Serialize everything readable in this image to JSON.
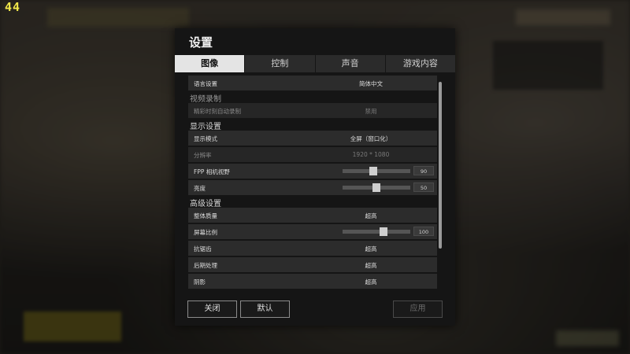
{
  "overlay": {
    "fps": "44"
  },
  "dialog": {
    "title": "设置",
    "tabs": [
      {
        "label": "图像",
        "active": true
      },
      {
        "label": "控制",
        "active": false
      },
      {
        "label": "声音",
        "active": false
      },
      {
        "label": "游戏内容",
        "active": false
      }
    ],
    "sections": {
      "language": {
        "label": "语言设置",
        "value": "简体中文"
      },
      "video_recording": {
        "title": "视频录制",
        "highlight": {
          "label": "精彩时刻自动录制",
          "value": "禁用"
        }
      },
      "display": {
        "title": "显示设置",
        "mode": {
          "label": "显示模式",
          "value": "全屏（窗口化）"
        },
        "resolution": {
          "label": "分辨率",
          "value": "1920 * 1080"
        },
        "fov": {
          "label": "FPP 相机视野",
          "value": "90",
          "slider_fraction": 0.45
        },
        "brightness": {
          "label": "亮度",
          "value": "50",
          "slider_fraction": 0.5
        }
      },
      "advanced": {
        "title": "高级设置",
        "overall_quality": {
          "label": "整体质量",
          "value": "超高"
        },
        "screen_scale": {
          "label": "屏幕比例",
          "value": "100",
          "slider_fraction": 0.6
        },
        "anti_aliasing": {
          "label": "抗锯齿",
          "value": "超高"
        },
        "post_processing": {
          "label": "后期处理",
          "value": "超高"
        },
        "shadows": {
          "label": "阴影",
          "value": "超高"
        }
      }
    },
    "footer": {
      "close_label": "关闭",
      "default_label": "默认",
      "apply_label": "应用"
    }
  }
}
